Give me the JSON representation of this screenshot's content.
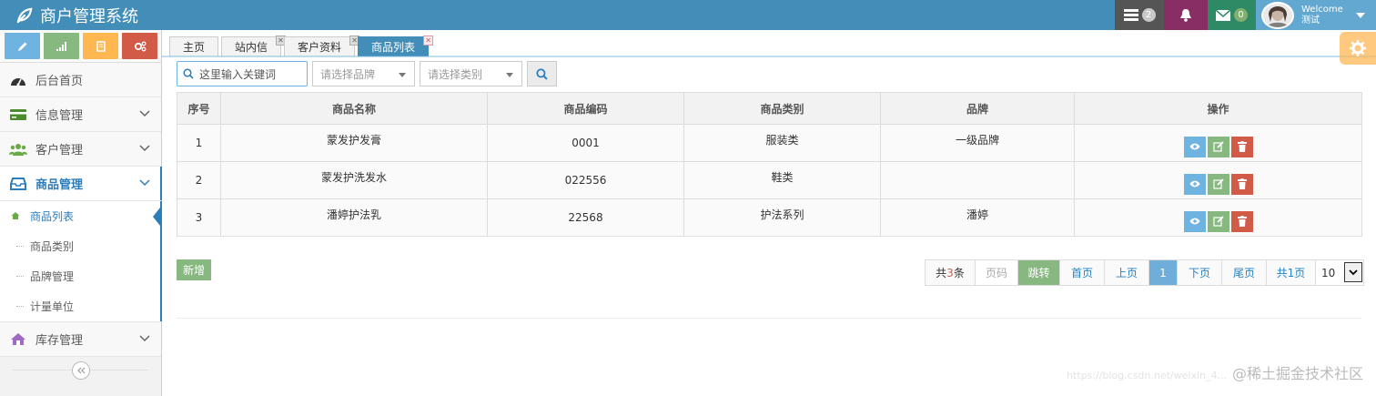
{
  "app": {
    "title": "商户管理系统"
  },
  "header": {
    "tasks_count": "2",
    "notifications_count": "",
    "messages_count": "0",
    "welcome": "Welcome",
    "user_name": "测试"
  },
  "sidebar": {
    "items": [
      {
        "label": "后台首页",
        "icon": "dashboard-icon"
      },
      {
        "label": "信息管理",
        "icon": "credit-card-icon"
      },
      {
        "label": "客户管理",
        "icon": "users-icon"
      },
      {
        "label": "商品管理",
        "icon": "inbox-icon"
      },
      {
        "label": "库存管理",
        "icon": "home-icon"
      }
    ],
    "submenu": [
      {
        "label": "商品列表"
      },
      {
        "label": "商品类别"
      },
      {
        "label": "品牌管理"
      },
      {
        "label": "计量单位"
      }
    ]
  },
  "tabs": [
    {
      "label": "主页"
    },
    {
      "label": "站内信"
    },
    {
      "label": "客户资料"
    },
    {
      "label": "商品列表"
    }
  ],
  "search": {
    "keyword_value": "这里输入关键词",
    "brand_placeholder": "请选择品牌",
    "category_placeholder": "请选择类别"
  },
  "table": {
    "headers": [
      "序号",
      "商品名称",
      "商品编码",
      "商品类别",
      "品牌",
      "操作"
    ],
    "rows": [
      {
        "no": "1",
        "name": "蒙发护发膏",
        "code": "0001",
        "category": "服装类",
        "brand": "一级品牌"
      },
      {
        "no": "2",
        "name": "蒙发护洗发水",
        "code": "022556",
        "category": "鞋类",
        "brand": ""
      },
      {
        "no": "3",
        "name": "潘婷护法乳",
        "code": "22568",
        "category": "护法系列",
        "brand": "潘婷"
      }
    ]
  },
  "actions": {
    "add_label": "新增"
  },
  "pager": {
    "total_prefix": "共",
    "total_count": "3",
    "total_suffix": "条",
    "page_input_placeholder": "页码",
    "jump": "跳转",
    "first": "首页",
    "prev": "上页",
    "current": "1",
    "next": "下页",
    "last": "尾页",
    "pages_total": "共1页",
    "page_size": "10"
  },
  "watermark": {
    "faint": "https://blog.csdn.net/weixin_4...",
    "text": "@稀土掘金技术社区"
  },
  "colors": {
    "navbar": "#438eb9",
    "accent": "#2b7dbc",
    "success": "#87b87f",
    "danger": "#d15b47",
    "info": "#6fb3e0",
    "warning": "#ffb752"
  }
}
